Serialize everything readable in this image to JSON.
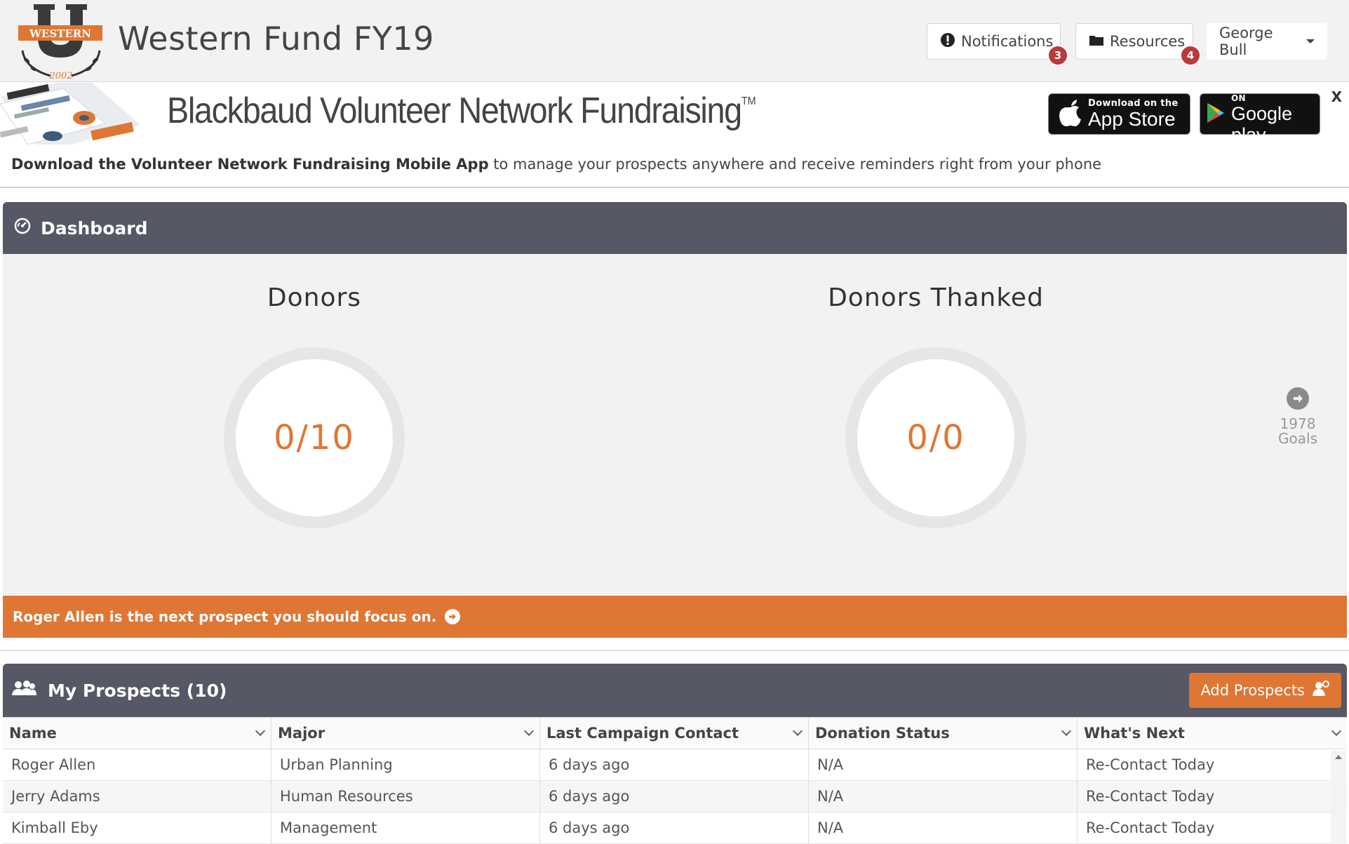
{
  "header": {
    "logo_text": "WESTERN",
    "logo_year": "2002",
    "title": "Western Fund FY19",
    "notifications": {
      "label": "Notifications",
      "count": "3",
      "icon": "exclamation-circle-icon"
    },
    "resources": {
      "label": "Resources",
      "count": "4",
      "icon": "folder-icon"
    },
    "user_menu": {
      "label": "George Bull"
    }
  },
  "app_banner": {
    "title": "Blackbaud Volunteer Network Fundraising",
    "trademark": "TM",
    "app_store": {
      "small": "Download on the",
      "big": "App Store"
    },
    "google_play": {
      "small": "ANDROID APP ON",
      "big": "Google play"
    },
    "close_label": "X",
    "message_bold": "Download the Volunteer Network Fundraising Mobile App",
    "message_rest": " to manage your prospects anywhere and receive reminders right from your phone"
  },
  "dashboard": {
    "title": "Dashboard",
    "gauges": [
      {
        "title": "Donors",
        "value": "0/10"
      },
      {
        "title": "Donors Thanked",
        "value": "0/0"
      }
    ],
    "goals": {
      "count": "1978",
      "label": "Goals"
    }
  },
  "focus": {
    "text": "Roger Allen is the next prospect you should focus on."
  },
  "prospects": {
    "title": "My Prospects (10)",
    "add_label": "Add Prospects",
    "columns": [
      "Name",
      "Major",
      "Last Campaign Contact",
      "Donation Status",
      "What's Next"
    ],
    "rows": [
      [
        "Roger Allen",
        "Urban Planning",
        "6 days ago",
        "N/A",
        "Re-Contact Today"
      ],
      [
        "Jerry Adams",
        "Human Resources",
        "6 days ago",
        "N/A",
        "Re-Contact Today"
      ],
      [
        "Kimball Eby",
        "Management",
        "6 days ago",
        "N/A",
        "Re-Contact Today"
      ]
    ]
  },
  "colors": {
    "accent_orange": "#e07634",
    "panel_header": "#575866",
    "badge_red": "#b83a3a"
  }
}
